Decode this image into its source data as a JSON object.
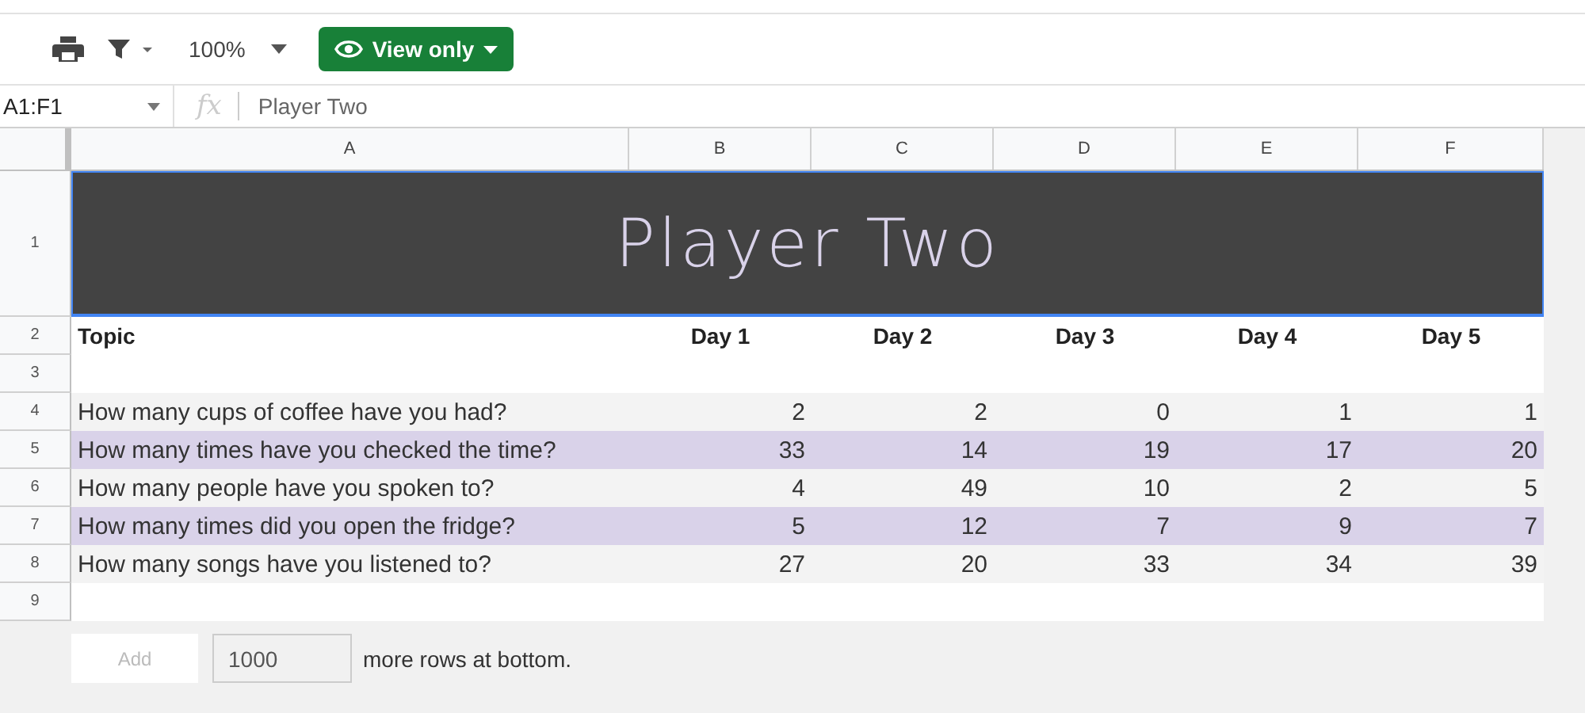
{
  "toolbar": {
    "zoom": "100%",
    "view_button": "View only"
  },
  "formula_bar": {
    "name_box": "A1:F1",
    "fx": "fx",
    "value": "Player Two"
  },
  "columns": [
    "A",
    "B",
    "C",
    "D",
    "E",
    "F"
  ],
  "title_row": {
    "row_number": "1",
    "text": "Player Two",
    "selected": true
  },
  "header_row": {
    "row_number": "2",
    "cells": [
      "Topic",
      "Day 1",
      "Day 2",
      "Day 3",
      "Day 4",
      "Day 5"
    ]
  },
  "rows": [
    {
      "row_number": "3",
      "cells": []
    },
    {
      "row_number": "4",
      "color": "#f3f3f3",
      "cells": [
        "How many cups of coffee have you had?",
        "2",
        "2",
        "0",
        "1",
        "1"
      ]
    },
    {
      "row_number": "5",
      "color": "#d9d2e9",
      "cells": [
        "How many times have you checked the time?",
        "33",
        "14",
        "19",
        "17",
        "20"
      ]
    },
    {
      "row_number": "6",
      "color": "#f3f3f3",
      "cells": [
        "How many people have you spoken to?",
        "4",
        "49",
        "10",
        "2",
        "5"
      ]
    },
    {
      "row_number": "7",
      "color": "#d9d2e9",
      "cells": [
        "How many times did you open the fridge?",
        "5",
        "12",
        "7",
        "9",
        "7"
      ]
    },
    {
      "row_number": "8",
      "color": "#f3f3f3",
      "cells": [
        "How many songs have you listened to?",
        "27",
        "20",
        "33",
        "34",
        "39"
      ]
    },
    {
      "row_number": "9",
      "cells": []
    }
  ],
  "footer": {
    "add_button": "Add",
    "rows_value": "1000",
    "text": "more rows at bottom."
  }
}
